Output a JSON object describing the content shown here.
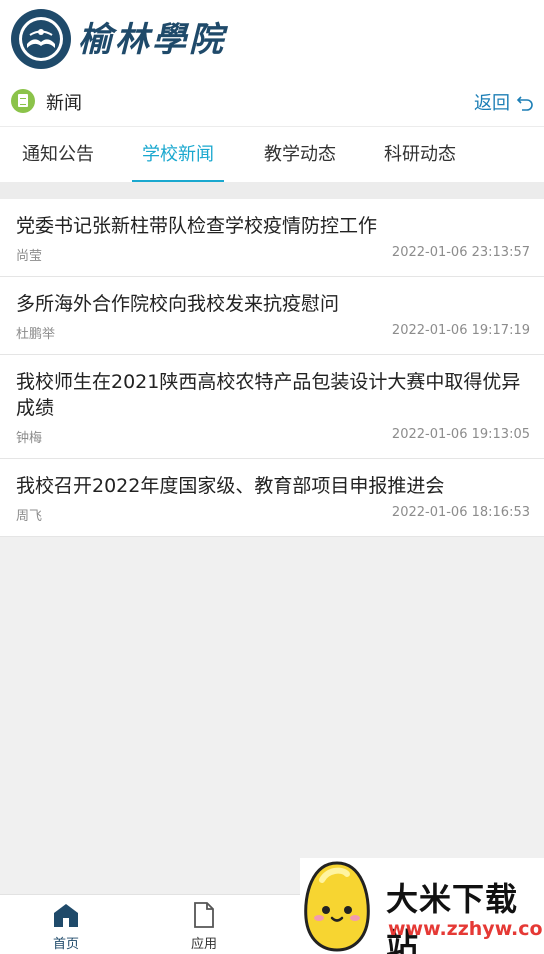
{
  "header": {
    "logo_text": "榆林學院"
  },
  "subbar": {
    "section_title": "新闻",
    "back_label": "返回"
  },
  "tabs": [
    {
      "label": "通知公告",
      "active": false
    },
    {
      "label": "学校新闻",
      "active": true
    },
    {
      "label": "教学动态",
      "active": false
    },
    {
      "label": "科研动态",
      "active": false
    }
  ],
  "news": [
    {
      "title": "党委书记张新柱带队检查学校疫情防控工作",
      "author": "尚莹",
      "time": "2022-01-06 23:13:57"
    },
    {
      "title": "多所海外合作院校向我校发来抗疫慰问",
      "author": "杜鹏举",
      "time": "2022-01-06 19:17:19"
    },
    {
      "title": "我校师生在2021陕西高校农特产品包装设计大赛中取得优异成绩",
      "author": "钟梅",
      "time": "2022-01-06 19:13:05"
    },
    {
      "title": "我校召开2022年度国家级、教育部项目申报推进会",
      "author": "周飞",
      "time": "2022-01-06 18:16:53"
    }
  ],
  "tabbar": [
    {
      "label": "首页",
      "icon": "home-icon",
      "active": true
    },
    {
      "label": "应用",
      "icon": "document-icon",
      "active": false
    }
  ],
  "watermark": {
    "name": "大米下载站",
    "url": "www.zzhyw.com"
  },
  "colors": {
    "accent": "#1aa8cf",
    "brand": "#1f4a6a",
    "back_link": "#1d7fb6",
    "news_icon": "#8bc34a"
  }
}
